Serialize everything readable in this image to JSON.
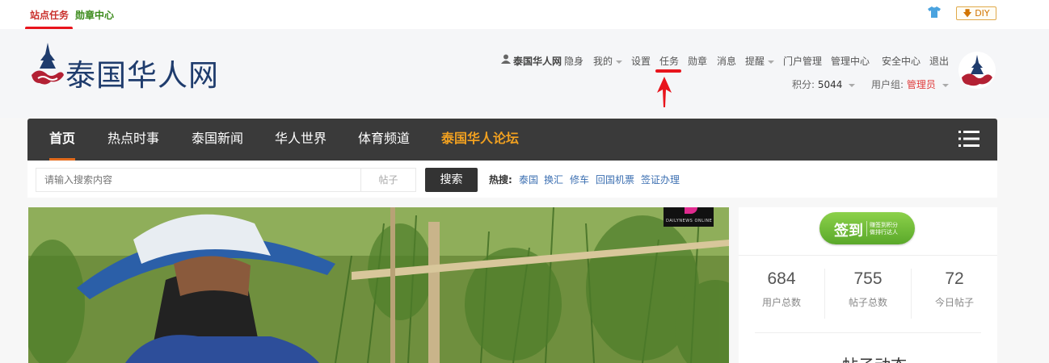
{
  "topbar": {
    "site_tasks": "站点任务",
    "medal_center": "勋章中心",
    "diy": "DIY"
  },
  "header": {
    "logo_text": "泰国华人网",
    "user": {
      "username": "泰国华人网",
      "invisible": "隐身",
      "my": "我的",
      "settings": "设置",
      "tasks": "任务",
      "medals": "勋章",
      "messages": "消息",
      "reminders": "提醒",
      "portal_admin": "门户管理",
      "admin_center": "管理中心",
      "security_center": "安全中心",
      "logout": "退出"
    },
    "score_label": "积分: ",
    "score_value": "5044",
    "group_label": "用户组: ",
    "group_value": "管理员"
  },
  "nav": {
    "items": [
      "首页",
      "热点时事",
      "泰国新闻",
      "华人世界",
      "体育频道",
      "泰国华人论坛"
    ]
  },
  "search": {
    "placeholder": "请输入搜索内容",
    "type": "帖子",
    "button": "搜索",
    "hot_label": "热搜:",
    "hot_links": [
      "泰国",
      "换汇",
      "修车",
      "回国机票",
      "签证办理"
    ]
  },
  "hero": {
    "watermark": "DAILYNEWS ONLINE"
  },
  "sidebar": {
    "checkin_main": "签到",
    "checkin_sub1": "赚签到积分",
    "checkin_sub2": "做排行达人",
    "stats": [
      {
        "value": "684",
        "label": "用户总数"
      },
      {
        "value": "755",
        "label": "帖子总数"
      },
      {
        "value": "72",
        "label": "今日帖子"
      }
    ],
    "section_title": "帖子动态"
  },
  "colors": {
    "accent_red": "#e8141c",
    "nav_bg": "#3a3a3a",
    "forum_orange": "#f0a020",
    "link_blue": "#3d70b2",
    "checkin_green": "#6cba34"
  }
}
